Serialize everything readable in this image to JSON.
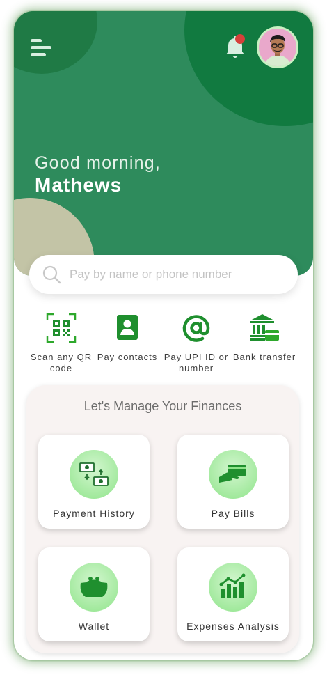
{
  "header": {
    "greeting": "Good morning,",
    "username": "Mathews",
    "colors": {
      "primary": "#2e8b5c",
      "dark": "#117a40",
      "accent_blob": "#c3c4a6",
      "notification": "#d6403a"
    }
  },
  "search": {
    "placeholder": "Pay by name or phone number"
  },
  "quick_actions": [
    {
      "label": "Scan any QR code",
      "icon": "qr-code-icon"
    },
    {
      "label": "Pay contacts",
      "icon": "contact-icon"
    },
    {
      "label": "Pay UPI ID or number",
      "icon": "at-sign-icon"
    },
    {
      "label": "Bank transfer",
      "icon": "bank-icon"
    }
  ],
  "finance": {
    "title": "Let's Manage Your Finances",
    "cards": [
      {
        "label": "Payment History",
        "icon": "money-exchange-icon"
      },
      {
        "label": "Pay Bills",
        "icon": "hand-card-icon"
      },
      {
        "label": "Wallet",
        "icon": "wallet-icon"
      },
      {
        "label": "Expenses Analysis",
        "icon": "chart-icon"
      }
    ]
  }
}
